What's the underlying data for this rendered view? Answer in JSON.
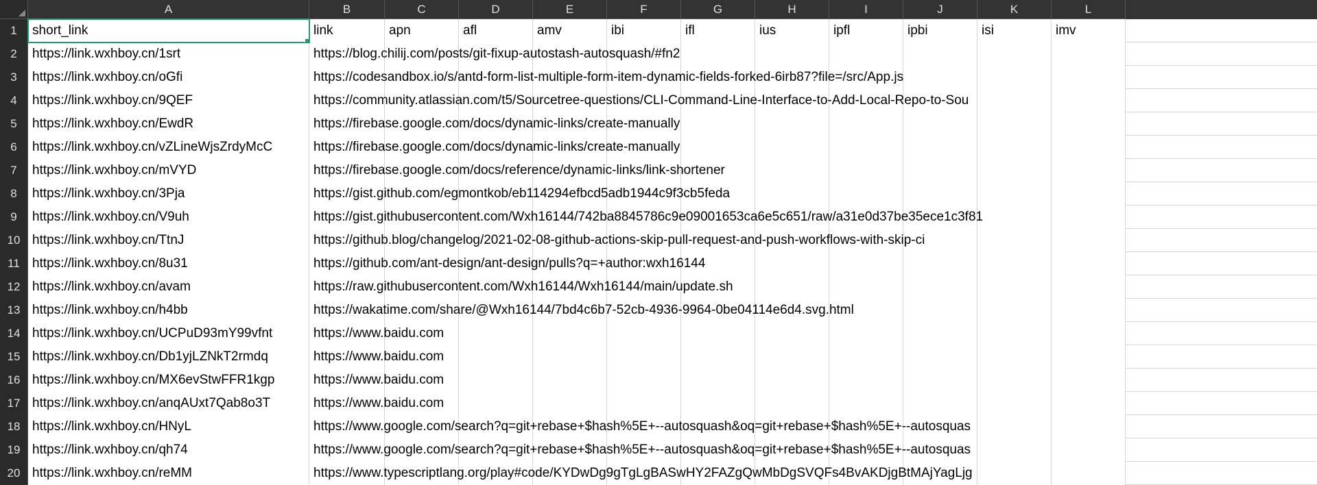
{
  "columns": [
    "A",
    "B",
    "C",
    "D",
    "E",
    "F",
    "G",
    "H",
    "I",
    "J",
    "K",
    "L"
  ],
  "headers": {
    "A": "short_link",
    "B": "link",
    "C": "apn",
    "D": "afl",
    "E": "amv",
    "F": "ibi",
    "G": "ifl",
    "H": "ius",
    "I": "ipfl",
    "J": "ipbi",
    "K": "isi",
    "L": "imv"
  },
  "rows": [
    {
      "n": 1,
      "A": "short_link",
      "B": "link",
      "C": "apn",
      "D": "afl",
      "E": "amv",
      "F": "ibi",
      "G": "ifl",
      "H": "ius",
      "I": "ipfl",
      "J": "ipbi",
      "K": "isi",
      "L": "imv"
    },
    {
      "n": 2,
      "A": "https://link.wxhboy.cn/1srt",
      "B": "https://blog.chilij.com/posts/git-fixup-autostash-autosquash/#fn2"
    },
    {
      "n": 3,
      "A": "https://link.wxhboy.cn/oGfi",
      "B": "https://codesandbox.io/s/antd-form-list-multiple-form-item-dynamic-fields-forked-6irb87?file=/src/App.js"
    },
    {
      "n": 4,
      "A": "https://link.wxhboy.cn/9QEF",
      "B": "https://community.atlassian.com/t5/Sourcetree-questions/CLI-Command-Line-Interface-to-Add-Local-Repo-to-Sou"
    },
    {
      "n": 5,
      "A": "https://link.wxhboy.cn/EwdR",
      "B": "https://firebase.google.com/docs/dynamic-links/create-manually"
    },
    {
      "n": 6,
      "A": "https://link.wxhboy.cn/vZLineWjsZrdyMcC",
      "B": "https://firebase.google.com/docs/dynamic-links/create-manually"
    },
    {
      "n": 7,
      "A": "https://link.wxhboy.cn/mVYD",
      "B": "https://firebase.google.com/docs/reference/dynamic-links/link-shortener"
    },
    {
      "n": 8,
      "A": "https://link.wxhboy.cn/3Pja",
      "B": "https://gist.github.com/egmontkob/eb114294efbcd5adb1944c9f3cb5feda"
    },
    {
      "n": 9,
      "A": "https://link.wxhboy.cn/V9uh",
      "B": "https://gist.githubusercontent.com/Wxh16144/742ba8845786c9e09001653ca6e5c651/raw/a31e0d37be35ece1c3f81"
    },
    {
      "n": 10,
      "A": "https://link.wxhboy.cn/TtnJ",
      "B": "https://github.blog/changelog/2021-02-08-github-actions-skip-pull-request-and-push-workflows-with-skip-ci"
    },
    {
      "n": 11,
      "A": "https://link.wxhboy.cn/8u31",
      "B": "https://github.com/ant-design/ant-design/pulls?q=+author:wxh16144"
    },
    {
      "n": 12,
      "A": "https://link.wxhboy.cn/avam",
      "B": "https://raw.githubusercontent.com/Wxh16144/Wxh16144/main/update.sh"
    },
    {
      "n": 13,
      "A": "https://link.wxhboy.cn/h4bb",
      "B": "https://wakatime.com/share/@Wxh16144/7bd4c6b7-52cb-4936-9964-0be04114e6d4.svg.html"
    },
    {
      "n": 14,
      "A": "https://link.wxhboy.cn/UCPuD93mY99vfnt",
      "B": "https://www.baidu.com"
    },
    {
      "n": 15,
      "A": "https://link.wxhboy.cn/Db1yjLZNkT2rmdq",
      "B": "https://www.baidu.com"
    },
    {
      "n": 16,
      "A": "https://link.wxhboy.cn/MX6evStwFFR1kgp",
      "B": "https://www.baidu.com"
    },
    {
      "n": 17,
      "A": "https://link.wxhboy.cn/anqAUxt7Qab8o3T",
      "B": "https://www.baidu.com"
    },
    {
      "n": 18,
      "A": "https://link.wxhboy.cn/HNyL",
      "B": "https://www.google.com/search?q=git+rebase+$hash%5E+--autosquash&oq=git+rebase+$hash%5E+--autosquas"
    },
    {
      "n": 19,
      "A": "https://link.wxhboy.cn/qh74",
      "B": "https://www.google.com/search?q=git+rebase+$hash%5E+--autosquash&oq=git+rebase+$hash%5E+--autosquas"
    },
    {
      "n": 20,
      "A": "https://link.wxhboy.cn/reMM",
      "B": "https://www.typescriptlang.org/play#code/KYDwDg9gTgLgBASwHY2FAZgQwMbDgSVQFs4BvAKDjgBtMAjYagLjg"
    }
  ],
  "selected": {
    "row": 1,
    "col": "A"
  }
}
